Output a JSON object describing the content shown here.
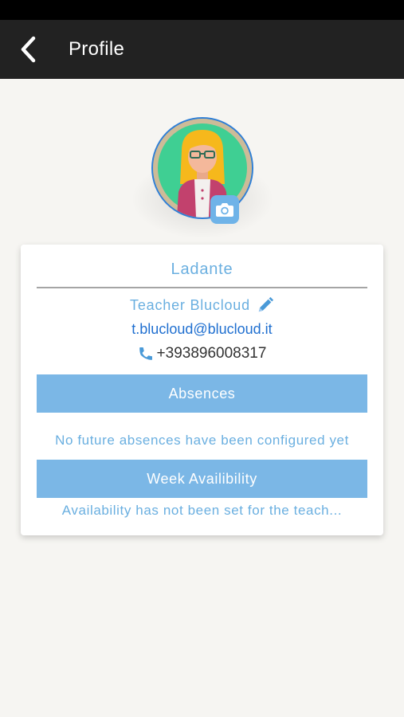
{
  "header": {
    "title": "Profile",
    "back_icon": "chevron-left-icon"
  },
  "avatar": {
    "camera_icon": "camera-icon"
  },
  "card": {
    "name": "Ladante",
    "teacher_name": "Teacher Blucloud",
    "edit_icon": "pencil-icon",
    "email": "t.blucloud@blucloud.it",
    "phone_icon": "phone-icon",
    "phone": "+393896008317",
    "absences_label": "Absences",
    "absences_note": "No future absences have been configured yet",
    "availability_label": "Week Availibility",
    "availability_note": "Availability has not been set for the teach..."
  },
  "colors": {
    "app_bar": "#222222",
    "accent": "#7bb7e6",
    "link": "#1f6fd0",
    "text_blue": "#6aafe0",
    "background": "#f6f5f2"
  }
}
